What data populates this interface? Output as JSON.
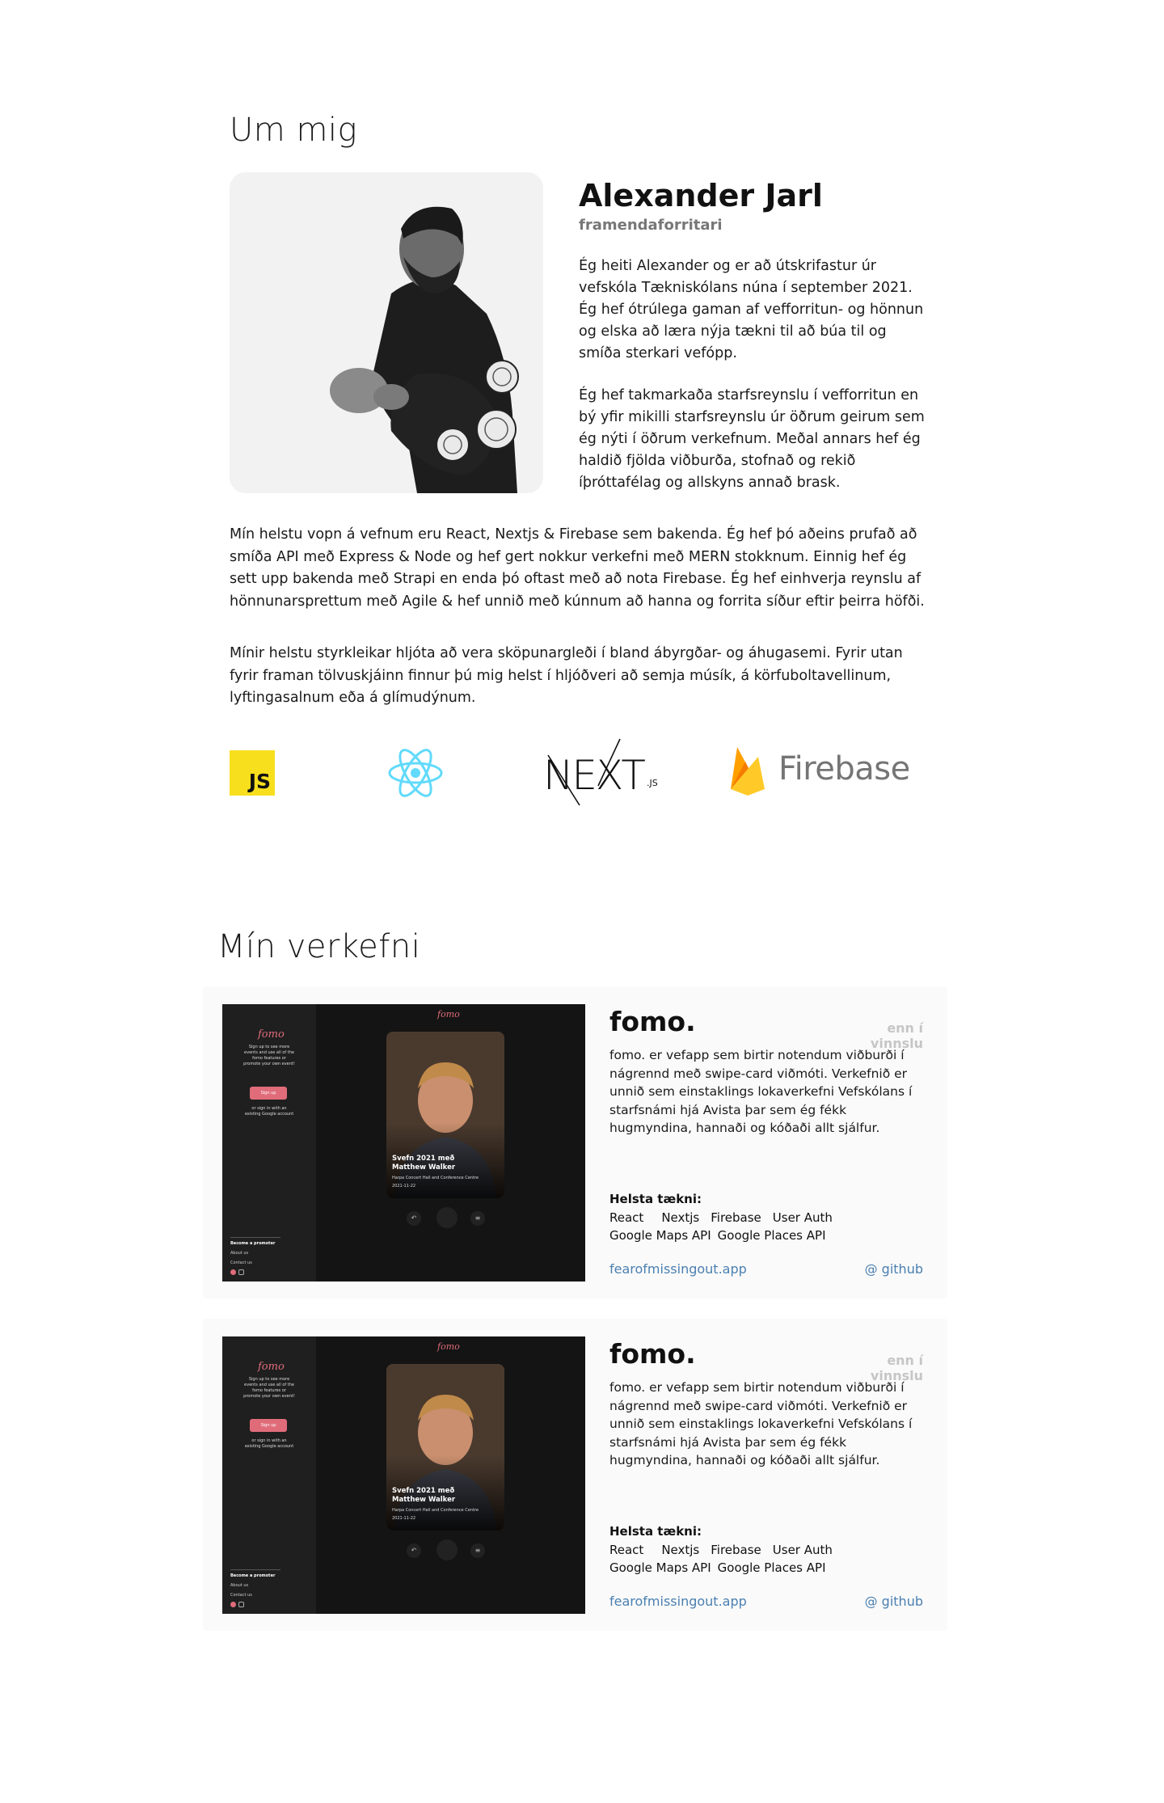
{
  "about": {
    "heading": "Um mig",
    "name": "Alexander Jarl",
    "role": "framendaforritari",
    "bio_1": "Ég heiti Alexander og er að útskrifastur úr vefskóla Tækniskólans núna í september 2021. Ég hef ótrúlega gaman af vefforritun- og hönnun og elska að læra nýja tækni til að búa til og smíða sterkari vefópp.",
    "bio_2": "Ég hef takmarkaða starfsreynslu í vefforritun en bý yfir mikilli starfsreynslu úr öðrum geirum sem ég nýti í öðrum verkefnum. Meðal annars hef ég haldið fjölda viðburða, stofnað og rekið íþróttafélag og allskyns annað brask.",
    "para_1": "Mín helstu vopn á vefnum eru React, Nextjs & Firebase sem bakenda. Ég hef þó aðeins prufað að smíða API með Express & Node og hef gert nokkur verkefni með MERN stokknum. Einnig hef ég sett upp bakenda með Strapi en enda þó oftast með að nota Firebase. Ég hef einhverja reynslu af hönnunarsprettum með Agile & hef unnið með kúnnum að hanna og forrita síður eftir þeirra höfði.",
    "para_2": "Mínir helstu styrkleikar hljóta að vera sköpunargleði í bland ábyrgðar- og áhugasemi. Fyrir utan fyrir framan tölvuskjáinn finnur þú mig helst í hljóðveri að semja músík, á körfuboltavellinum, lyftingasalnum eða á glímudýnum.",
    "logos": {
      "js": "JS",
      "next": "NEXT",
      "next_suffix": ".JS",
      "firebase": "Firebase"
    }
  },
  "projects": {
    "heading": "Mín verkefni",
    "items": [
      {
        "title": "fomo.",
        "status": "enn í vinnslu",
        "description": "fomo. er vefapp sem birtir notendum viðburði í nágrennd með swipe-card viðmóti. Verkefnið er unnið sem einstaklings lokaverkefni Vefskólans í starfsnámi hjá Avista þar sem ég fékk hugmyndina, hannaði og kóðaði allt sjálfur.",
        "tech_title": "Helsta tækni:",
        "tech_row_1": [
          "React",
          "Nextjs",
          "Firebase",
          "User Auth"
        ],
        "tech_row_2": [
          "Google Maps API",
          "Google Places API"
        ],
        "site_link": "fearofmissingout.app",
        "github_link": "@ github",
        "screenshot": {
          "logo": "fomo",
          "sidebar_logo": "fomo",
          "sidebar_text": "Sign up to see more events and use all of the fomo features or promote your own event!",
          "signup": "Sign up",
          "signin_text": "or sign in with an existing Google account",
          "menu": [
            "Become a promoter",
            "About us",
            "Contact us"
          ],
          "card_title": "Svefn 2021 með Matthew Walker",
          "card_venue": "Harpa Concert Hall and Conference Centre",
          "card_date": "2021-11-22"
        }
      },
      {
        "title": "fomo.",
        "status": "enn í vinnslu",
        "description": "fomo. er vefapp sem birtir notendum viðburði í nágrennd með swipe-card viðmóti. Verkefnið er unnið sem einstaklings lokaverkefni Vefskólans í starfsnámi hjá Avista þar sem ég fékk hugmyndina, hannaði og kóðaði allt sjálfur.",
        "tech_title": "Helsta tækni:",
        "tech_row_1": [
          "React",
          "Nextjs",
          "Firebase",
          "User Auth"
        ],
        "tech_row_2": [
          "Google Maps API",
          "Google Places API"
        ],
        "site_link": "fearofmissingout.app",
        "github_link": "@ github",
        "screenshot": {
          "logo": "fomo",
          "sidebar_logo": "fomo",
          "sidebar_text": "Sign up to see more events and use all of the fomo features or promote your own event!",
          "signup": "Sign up",
          "signin_text": "or sign in with an existing Google account",
          "menu": [
            "Become a promoter",
            "About us",
            "Contact us"
          ],
          "card_title": "Svefn 2021 með Matthew Walker",
          "card_venue": "Harpa Concert Hall and Conference Centre",
          "card_date": "2021-11-22"
        }
      }
    ]
  },
  "colors": {
    "accent_link": "#4a7fb0",
    "js_yellow": "#f7df1e",
    "react_blue": "#61dafb",
    "firebase_orange": "#ffa000",
    "fomo_pink": "#e06c7a"
  }
}
